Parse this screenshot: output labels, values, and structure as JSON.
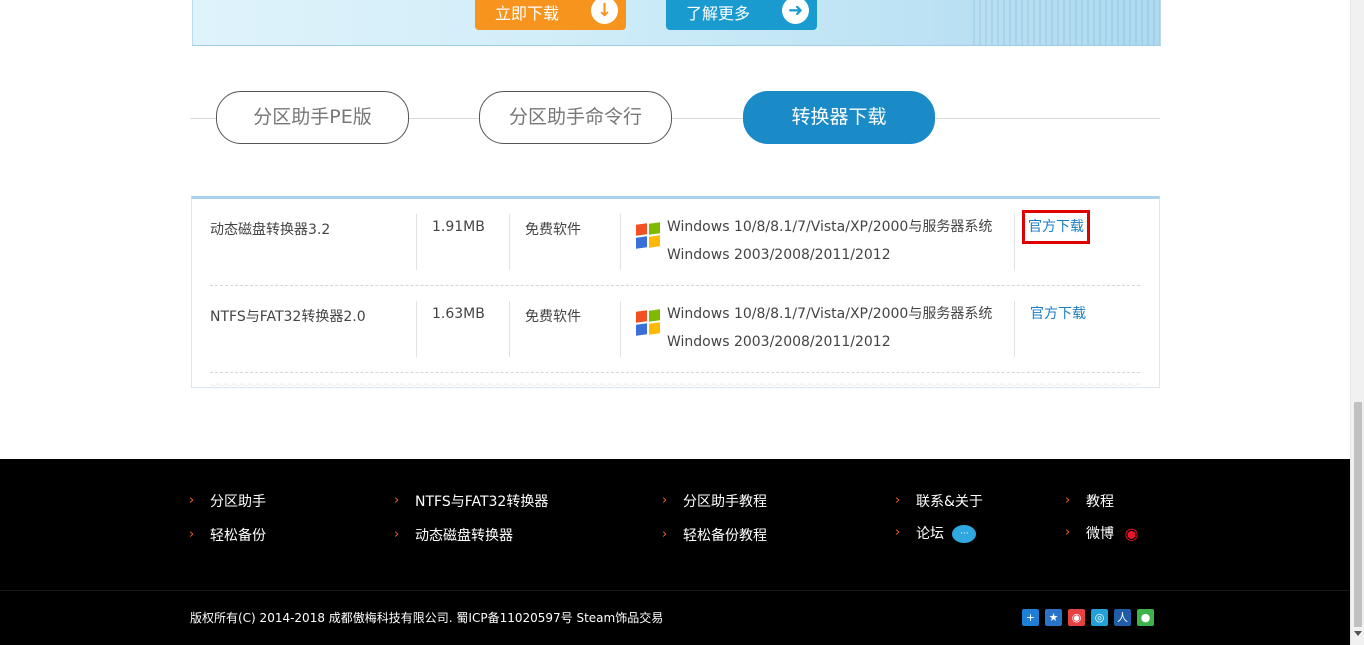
{
  "banner": {
    "download_label": "立即下载",
    "more_label": "了解更多"
  },
  "tabs": [
    {
      "label": "分区助手PE版",
      "active": false
    },
    {
      "label": "分区助手命令行",
      "active": false
    },
    {
      "label": "转换器下载",
      "active": true
    }
  ],
  "downloads": [
    {
      "name": "动态磁盘转换器3.2",
      "size": "1.91MB",
      "license": "免费软件",
      "os_line1": "Windows 10/8/8.1/7/Vista/XP/2000与服务器系统",
      "os_line2": "Windows 2003/2008/2011/2012",
      "link": "官方下载",
      "highlighted": true
    },
    {
      "name": "NTFS与FAT32转换器2.0",
      "size": "1.63MB",
      "license": "免费软件",
      "os_line1": "Windows 10/8/8.1/7/Vista/XP/2000与服务器系统",
      "os_line2": "Windows 2003/2008/2011/2012",
      "link": "官方下载",
      "highlighted": false
    }
  ],
  "footer": {
    "links": {
      "c1r1": "分区助手",
      "c1r2": "轻松备份",
      "c2r1": "NTFS与FAT32转换器",
      "c2r2": "动态磁盘转换器",
      "c3r1": "分区助手教程",
      "c3r2": "轻松备份教程",
      "c4r1": "联系&关于",
      "c4r2": "论坛",
      "c5r1": "教程",
      "c5r2": "微博"
    },
    "copyright": "版权所有(C) 2014-2018 成都傲梅科技有限公司. 蜀ICP备11020597号   Steam饰品交易"
  },
  "share_icons": [
    {
      "name": "share-more-icon",
      "color": "#1e7fd6"
    },
    {
      "name": "qzone-icon",
      "color": "#2a73c9"
    },
    {
      "name": "sina-weibo-icon",
      "color": "#e64141"
    },
    {
      "name": "tencent-weibo-icon",
      "color": "#23a0d8"
    },
    {
      "name": "renren-icon",
      "color": "#1f5da8"
    },
    {
      "name": "wechat-icon",
      "color": "#3db34a"
    }
  ],
  "colors": {
    "accent": "#1a8bc7",
    "orange": "#f7941d",
    "link": "#1a7fc3",
    "footer_bg": "#000000"
  }
}
